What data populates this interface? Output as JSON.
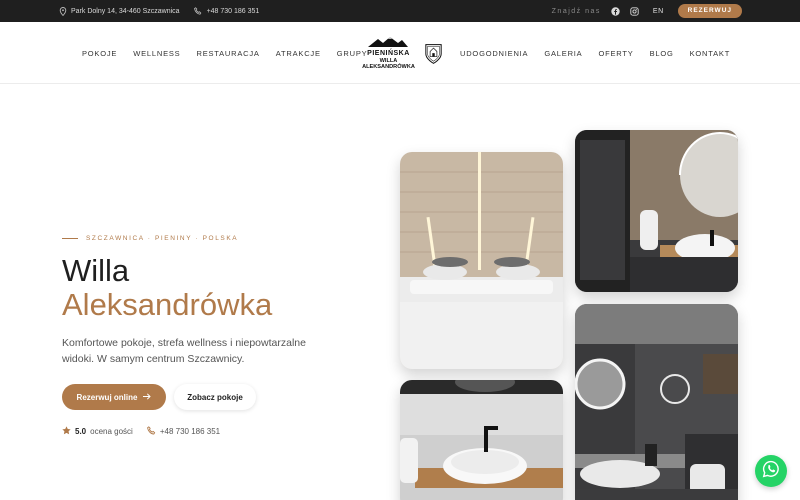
{
  "topbar": {
    "address": "Park Dolny 14, 34-460 Szczawnica",
    "phone": "+48 730 186 351",
    "find_us": "Znajdź nas",
    "lang": "EN",
    "cta": "REZERWUJ"
  },
  "nav": {
    "left": [
      "POKOJE",
      "WELLNESS",
      "RESTAURACJA",
      "ATRAKCJE",
      "GRUPY"
    ],
    "right": [
      "UDOGODNIENIA",
      "GALERIA",
      "OFERTY",
      "BLOG",
      "KONTAKT"
    ],
    "logo_line1": "PIENIŃSKA",
    "logo_line2": "WILLA ALEKSANDRÓWKA"
  },
  "hero": {
    "eyebrow": "SZCZAWNICA · PIENINY · POLSKA",
    "title_line1": "Willa",
    "title_line2": "Aleksandrówka",
    "lead": "Komfortowe pokoje, strefa wellness i niepowtarzalne widoki. W samym centrum Szczawnicy.",
    "primary_cta": "Rezerwuj online",
    "secondary_cta": "Zobacz pokoje",
    "rating_value": "5.0",
    "rating_label": "ocena gości",
    "phone": "+48 730 186 351"
  },
  "colors": {
    "accent": "#b07a4a",
    "topbar_bg": "#1f1f1f",
    "whatsapp": "#25d366"
  },
  "icons": [
    "map-pin-icon",
    "phone-icon",
    "facebook-icon",
    "instagram-icon",
    "star-icon",
    "arrow-right-icon",
    "whatsapp-icon"
  ]
}
